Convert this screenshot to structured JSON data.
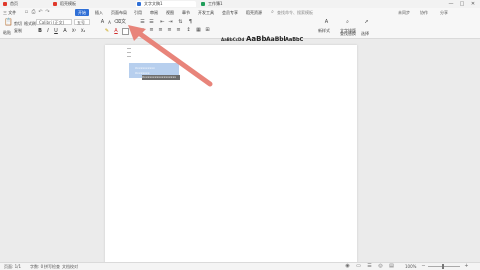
{
  "titlebar": {
    "tabs": [
      {
        "label": "首页",
        "color": "#e0392b"
      },
      {
        "label": "稻壳模板",
        "color": "#e0392b"
      },
      {
        "label": "文字文稿1",
        "color": "#2f6fd6"
      },
      {
        "label": "工作簿1",
        "color": "#1f9e5a"
      }
    ],
    "window_controls": [
      "—",
      "□",
      "✕"
    ]
  },
  "menubar": {
    "file_label": "三 文件",
    "items": [
      "开始",
      "插入",
      "页面布局",
      "引用",
      "审阅",
      "视图",
      "章节",
      "开发工具",
      "会员专享",
      "稻壳资源"
    ],
    "active_index": 0,
    "search_label": "查找命令、搜索模板",
    "right_items": [
      "未同步",
      "协作",
      "分享"
    ]
  },
  "ribbon": {
    "clipboard": [
      "粘贴",
      "剪切",
      "复制",
      "格式刷"
    ],
    "font_name": "Calibri (正文)",
    "font_size": "五号",
    "format_buttons": [
      "B",
      "I",
      "U",
      "A",
      "X²",
      "X₂",
      "A"
    ],
    "styles": [
      {
        "sample": "AaBbCcDd",
        "label": "正文"
      },
      {
        "sample": "AaBb",
        "label": "标题 1"
      },
      {
        "sample": "AaBbl",
        "label": "标题 2"
      },
      {
        "sample": "AaBbC",
        "label": "标题 3"
      }
    ],
    "right_tools": [
      "文字排版",
      "查找替换",
      "选择"
    ],
    "new_style_label": "新样式"
  },
  "document": {
    "selected_lines": [
      "Xxxxxxxxxxx",
      "Xxxxxxxx"
    ],
    "highlighted_text": "Xxxxxxxxxxxxxxxxxxx"
  },
  "statusbar": {
    "page": "页面: 1/1",
    "words": "字数: 0",
    "spellcheck": "拼写检查",
    "compat": "文档校对",
    "zoom": "100%"
  },
  "colors": {
    "accent": "#2f6fd6",
    "arrow": "#e8847a",
    "selection": "#b7cfee"
  }
}
